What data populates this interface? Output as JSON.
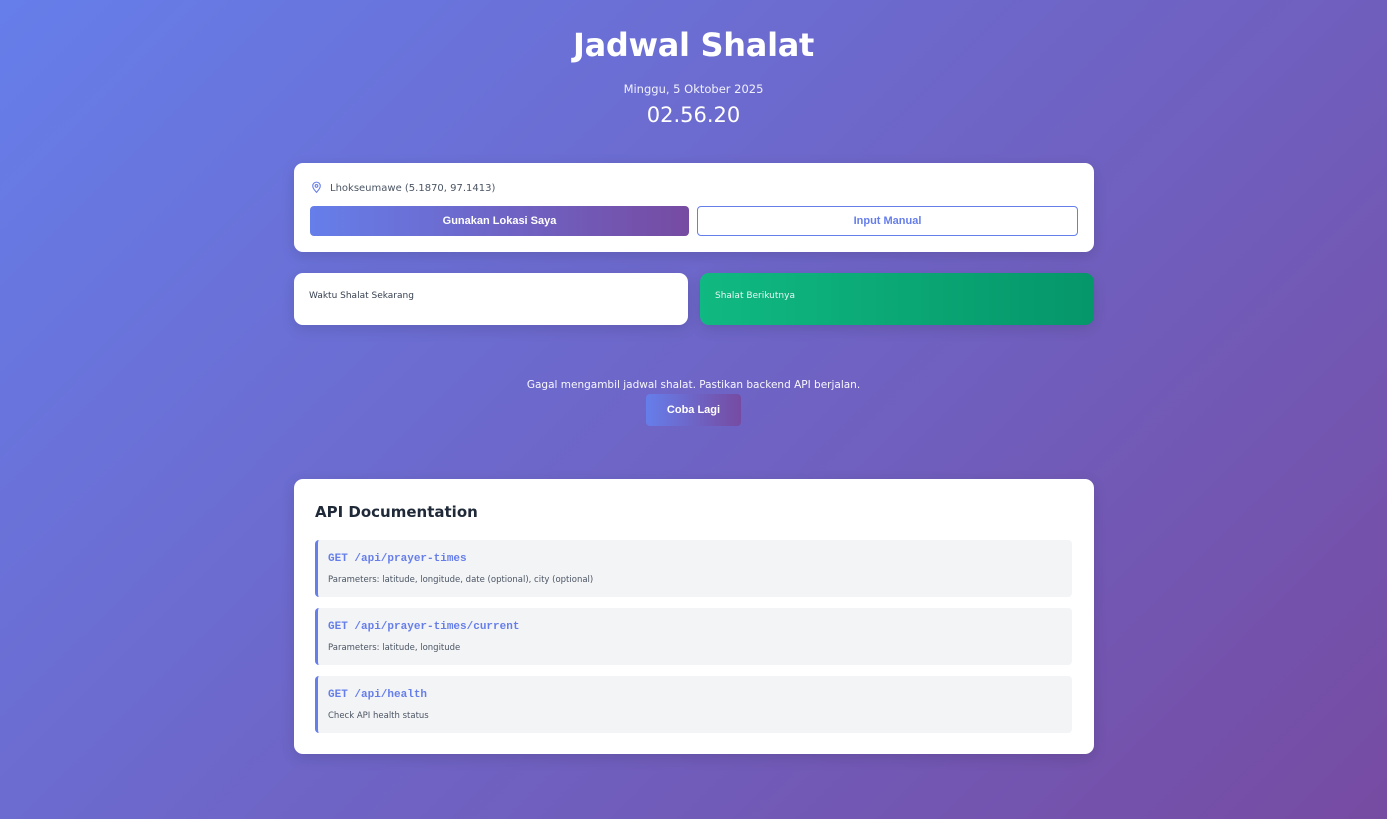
{
  "header": {
    "title": "Jadwal Shalat",
    "date": "Minggu, 5 Oktober 2025",
    "time": "02.56.20"
  },
  "location": {
    "icon": "map-pin-icon",
    "text": "Lhokseumawe (5.1870, 97.1413)",
    "use_location_label": "Gunakan Lokasi Saya",
    "manual_input_label": "Input Manual"
  },
  "prayer": {
    "current_label": "Waktu Shalat Sekarang",
    "next_label": "Shalat Berikutnya"
  },
  "error": {
    "message": "Gagal mengambil jadwal shalat. Pastikan backend API berjalan.",
    "retry_label": "Coba Lagi"
  },
  "api_docs": {
    "title": "API Documentation",
    "endpoints": [
      {
        "method": "GET /api/prayer-times",
        "description": "Parameters: latitude, longitude, date (optional), city (optional)"
      },
      {
        "method": "GET /api/prayer-times/current",
        "description": "Parameters: latitude, longitude"
      },
      {
        "method": "GET /api/health",
        "description": "Check API health status"
      }
    ]
  },
  "colors": {
    "gradient_start": "#667eea",
    "gradient_end": "#764ba2",
    "next_prayer_green": "#10b981"
  }
}
